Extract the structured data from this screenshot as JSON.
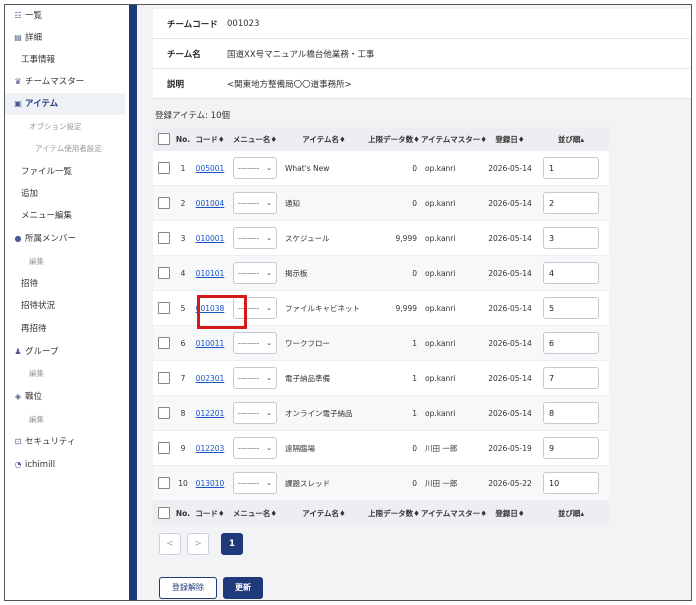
{
  "sidebar": {
    "items": [
      {
        "label": "一覧",
        "icon": "list-icon",
        "glyph": "☷",
        "sub": false,
        "active": false
      },
      {
        "label": "詳細",
        "icon": "document-icon",
        "glyph": "▤",
        "sub": false,
        "active": false
      },
      {
        "label": "工事情報",
        "icon": "",
        "glyph": "",
        "sub": false,
        "active": false
      },
      {
        "label": "チームマスター",
        "icon": "crown-icon",
        "glyph": "♛",
        "sub": false,
        "active": false
      },
      {
        "label": "アイテム",
        "icon": "box-icon",
        "glyph": "▣",
        "sub": false,
        "active": true
      },
      {
        "label": "オプション設定",
        "icon": "",
        "glyph": "",
        "sub": true,
        "active": false
      },
      {
        "label": "アイテム使用者設定",
        "icon": "",
        "glyph": "",
        "sub": true,
        "active": false
      },
      {
        "label": "ファイル一覧",
        "icon": "",
        "glyph": "",
        "sub": false,
        "active": false
      },
      {
        "label": "追加",
        "icon": "",
        "glyph": "",
        "sub": false,
        "active": false
      },
      {
        "label": "メニュー編集",
        "icon": "",
        "glyph": "",
        "sub": false,
        "active": false
      },
      {
        "label": "所属メンバー",
        "icon": "person-icon",
        "glyph": "●",
        "sub": false,
        "active": false
      },
      {
        "label": "編集",
        "icon": "",
        "glyph": "",
        "sub": true,
        "active": false
      },
      {
        "label": "招待",
        "icon": "",
        "glyph": "",
        "sub": false,
        "active": false
      },
      {
        "label": "招待状況",
        "icon": "",
        "glyph": "",
        "sub": false,
        "active": false
      },
      {
        "label": "再招待",
        "icon": "",
        "glyph": "",
        "sub": false,
        "active": false
      },
      {
        "label": "グループ",
        "icon": "group-icon",
        "glyph": "♟",
        "sub": false,
        "active": false
      },
      {
        "label": "編集",
        "icon": "",
        "glyph": "",
        "sub": true,
        "active": false
      },
      {
        "label": "職位",
        "icon": "layers-icon",
        "glyph": "◈",
        "sub": false,
        "active": false
      },
      {
        "label": "編集",
        "icon": "",
        "glyph": "",
        "sub": true,
        "active": false
      },
      {
        "label": "セキュリティ",
        "icon": "lock-icon",
        "glyph": "⊡",
        "sub": false,
        "active": false
      },
      {
        "label": "ichimill",
        "icon": "ichimill-icon",
        "glyph": "◔",
        "sub": false,
        "active": false
      }
    ]
  },
  "info": {
    "rows": [
      {
        "label": "チームコード",
        "value": "001023"
      },
      {
        "label": "チーム名",
        "value": "国道XX号マニュアル橋台他業務・工事"
      },
      {
        "label": "説明",
        "value": "<関東地方整備局〇〇道事務所>"
      }
    ]
  },
  "items_count": "登録アイテム: 10個",
  "table": {
    "headers": {
      "no": "No.",
      "code": "コード♦",
      "menu": "メニュー名♦",
      "name": "アイテム名♦",
      "limit": "上限データ数♦",
      "master": "アイテムマスター♦",
      "date": "登録日♦",
      "order": "並び順▴"
    },
    "select_text": "---------",
    "rows": [
      {
        "no": "1",
        "code": "005001",
        "name": "What's New",
        "limit": "0",
        "master": "op.kanri",
        "date": "2026-05-14",
        "order": "1"
      },
      {
        "no": "2",
        "code": "001004",
        "name": "通知",
        "limit": "0",
        "master": "op.kanri",
        "date": "2026-05-14",
        "order": "2"
      },
      {
        "no": "3",
        "code": "010001",
        "name": "スケジュール",
        "limit": "9,999",
        "master": "op.kanri",
        "date": "2026-05-14",
        "order": "3"
      },
      {
        "no": "4",
        "code": "010101",
        "name": "掲示板",
        "limit": "0",
        "master": "op.kanri",
        "date": "2026-05-14",
        "order": "4"
      },
      {
        "no": "5",
        "code": "001038",
        "name": "ファイルキャビネット",
        "limit": "9,999",
        "master": "op.kanri",
        "date": "2026-05-14",
        "order": "5"
      },
      {
        "no": "6",
        "code": "010011",
        "name": "ワークフロー",
        "limit": "1",
        "master": "op.kanri",
        "date": "2026-05-14",
        "order": "6"
      },
      {
        "no": "7",
        "code": "002301",
        "name": "電子納品準備",
        "limit": "1",
        "master": "op.kanri",
        "date": "2026-05-14",
        "order": "7"
      },
      {
        "no": "8",
        "code": "012201",
        "name": "オンライン電子納品",
        "limit": "1",
        "master": "op.kanri",
        "date": "2026-05-14",
        "order": "8"
      },
      {
        "no": "9",
        "code": "012203",
        "name": "遠隔臨場",
        "limit": "0",
        "master": "川田 一郎",
        "date": "2026-05-19",
        "order": "9"
      },
      {
        "no": "10",
        "code": "013010",
        "name": "課題スレッド",
        "limit": "0",
        "master": "川田 一郎",
        "date": "2026-05-22",
        "order": "10"
      }
    ]
  },
  "pagination": {
    "prev": "<",
    "next": ">",
    "current": "1"
  },
  "buttons": {
    "unregister": "登録解除",
    "update": "更新"
  },
  "colors": {
    "accent": "#1f3a7a",
    "highlight": "#d41a1a",
    "link": "#1a55c4"
  }
}
